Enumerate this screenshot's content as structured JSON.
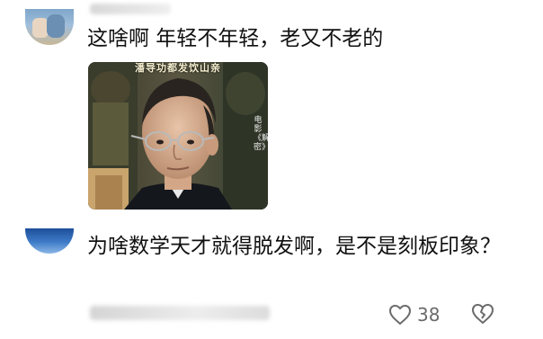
{
  "comments": [
    {
      "text": "这啥啊 年轻不年轻，老又不老的",
      "image": {
        "caption": "潘导功都发饮山亲",
        "watermark": "电影《解密》"
      }
    },
    {
      "text": "为啥数学天才就得脱发啊，是不是刻板印象？",
      "likes": "38"
    }
  ],
  "icons": {
    "like": "heart-outline-icon",
    "dislike": "broken-heart-icon"
  },
  "colors": {
    "text": "#111111",
    "secondary": "#6b6b6b"
  }
}
